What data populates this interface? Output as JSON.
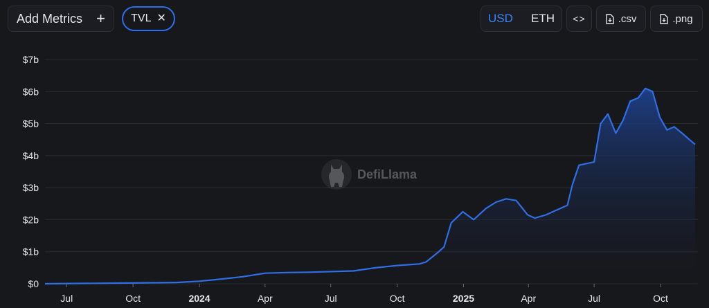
{
  "toolbar": {
    "add_metrics_label": "Add Metrics",
    "add_icon": "plus",
    "metric_chip": {
      "label": "TVL",
      "close_icon": "close"
    },
    "currency": {
      "options": [
        "USD",
        "ETH"
      ],
      "selected": "USD"
    },
    "embed_icon": "code",
    "csv_label": ".csv",
    "png_label": ".png",
    "download_icon": "file-download"
  },
  "watermark": {
    "text": "DefiLlama",
    "logo_icon": "llama-logo"
  },
  "colors": {
    "accent": "#2e6ff2",
    "line": "#2f6fe6",
    "background": "#17181c",
    "grid": "#2a2c31"
  },
  "chart_data": {
    "type": "area",
    "title": "",
    "series": [
      {
        "name": "TVL",
        "unit": "USD"
      }
    ],
    "y_tick_labels": [
      "$0",
      "$1b",
      "$2b",
      "$3b",
      "$4b",
      "$5b",
      "$6b",
      "$7b"
    ],
    "ylim": [
      0,
      7
    ],
    "y_unit": "billions USD",
    "x_tick_labels": [
      "Jul",
      "Oct",
      "2024",
      "Apr",
      "Jul",
      "Oct",
      "2025",
      "Apr",
      "Jul",
      "Oct"
    ],
    "x_tick_dates": [
      "2023-07",
      "2023-10",
      "2024-01",
      "2024-04",
      "2024-07",
      "2024-10",
      "2025-01",
      "2025-04",
      "2025-07",
      "2025-10"
    ],
    "bold_x_ticks": [
      "2024",
      "2025"
    ],
    "grid": "horizontal",
    "x": [
      "2023-06-01",
      "2023-09-01",
      "2023-12-01",
      "2024-01-01",
      "2024-02-01",
      "2024-03-01",
      "2024-04-01",
      "2024-05-01",
      "2024-06-01",
      "2024-07-01",
      "2024-08-01",
      "2024-09-01",
      "2024-10-01",
      "2024-11-01",
      "2024-11-10",
      "2024-11-25",
      "2024-12-05",
      "2024-12-15",
      "2024-12-31",
      "2025-01-15",
      "2025-02-01",
      "2025-02-15",
      "2025-03-01",
      "2025-03-15",
      "2025-03-31",
      "2025-04-10",
      "2025-04-25",
      "2025-05-10",
      "2025-05-25",
      "2025-06-01",
      "2025-06-10",
      "2025-06-20",
      "2025-07-01",
      "2025-07-10",
      "2025-07-20",
      "2025-07-31",
      "2025-08-10",
      "2025-08-20",
      "2025-08-31",
      "2025-09-10",
      "2025-09-20",
      "2025-09-30",
      "2025-10-10",
      "2025-10-20",
      "2025-10-31",
      "2025-11-10",
      "2025-11-18"
    ],
    "values": [
      0.0,
      0.02,
      0.04,
      0.08,
      0.15,
      0.22,
      0.33,
      0.35,
      0.36,
      0.38,
      0.4,
      0.5,
      0.57,
      0.62,
      0.68,
      0.95,
      1.15,
      1.9,
      2.25,
      2.0,
      2.35,
      2.55,
      2.65,
      2.6,
      2.15,
      2.05,
      2.15,
      2.3,
      2.45,
      3.1,
      3.7,
      3.75,
      3.8,
      5.0,
      5.3,
      4.7,
      5.1,
      5.7,
      5.8,
      6.1,
      6.0,
      5.2,
      4.8,
      4.9,
      4.7,
      4.5,
      4.35
    ]
  }
}
